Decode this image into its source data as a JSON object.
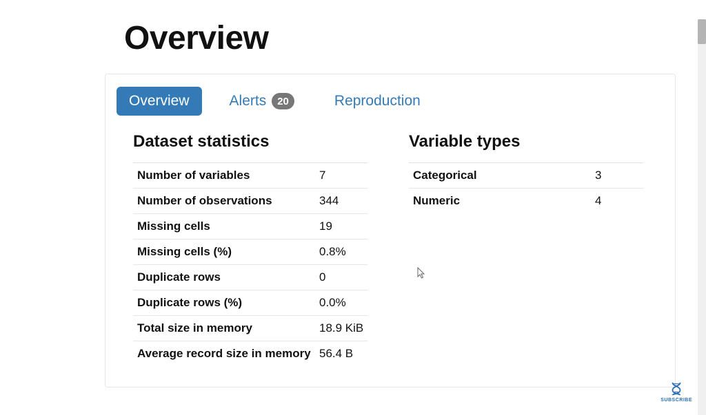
{
  "page": {
    "title": "Overview"
  },
  "tabs": {
    "overview": "Overview",
    "alerts": "Alerts",
    "alerts_count": "20",
    "reproduction": "Reproduction"
  },
  "sections": {
    "dataset_stats_title": "Dataset statistics",
    "variable_types_title": "Variable types"
  },
  "dataset_stats": [
    {
      "label": "Number of variables",
      "value": "7"
    },
    {
      "label": "Number of observations",
      "value": "344"
    },
    {
      "label": "Missing cells",
      "value": "19"
    },
    {
      "label": "Missing cells (%)",
      "value": "0.8%"
    },
    {
      "label": "Duplicate rows",
      "value": "0"
    },
    {
      "label": "Duplicate rows (%)",
      "value": "0.0%"
    },
    {
      "label": "Total size in memory",
      "value": "18.9 KiB"
    },
    {
      "label": "Average record size in memory",
      "value": "56.4 B"
    }
  ],
  "variable_types": [
    {
      "label": "Categorical",
      "value": "3"
    },
    {
      "label": "Numeric",
      "value": "4"
    }
  ],
  "subscribe": {
    "label": "SUBSCRIBE"
  }
}
